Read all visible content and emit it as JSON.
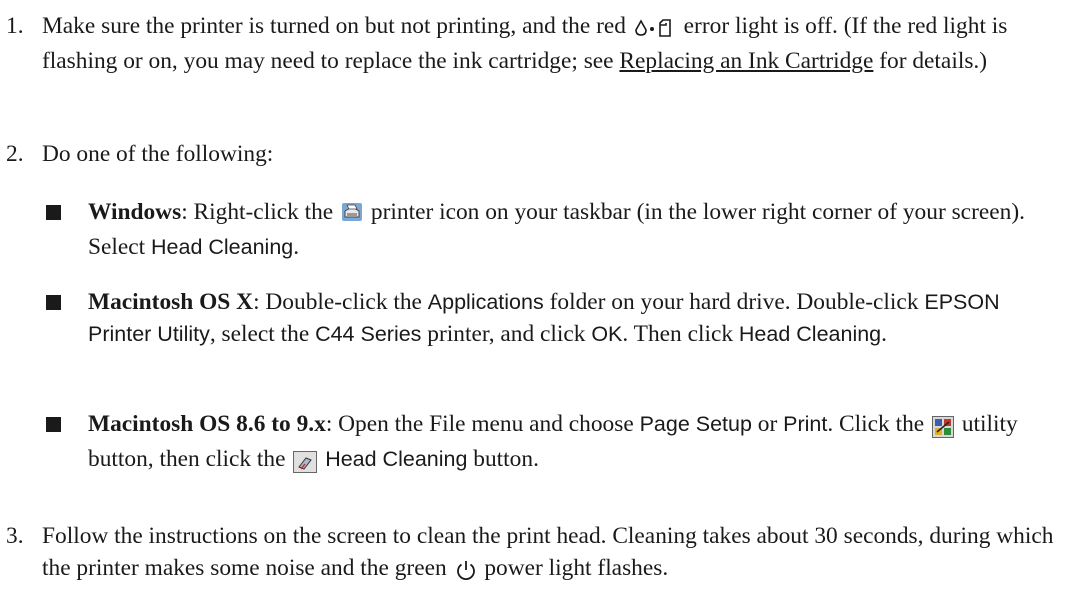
{
  "steps": [
    {
      "number": "1.",
      "t1": "Make sure the printer is turned on but not printing, and the red ",
      "t2": " error light is off. (If the red light is flashing or on, you may need to replace the ink cartridge; see ",
      "link": "Replacing an Ink Cartridge",
      "t3": " for details.)",
      "icon": "error-light-icon"
    },
    {
      "number": "2.",
      "text": "Do one of the following:"
    },
    {
      "number": "3.",
      "t1": "Follow the instructions on the screen to clean the print head. Cleaning takes about 30 seconds, during which the printer makes some noise and the green ",
      "t2": " power light flashes.",
      "icon": "power-icon"
    }
  ],
  "bullets": [
    {
      "heading": "Windows",
      "t1": ": Right-click the ",
      "t2": " printer icon on your taskbar (in the lower right corner of your screen). Select ",
      "ui1": "Head Cleaning",
      "t3": ".",
      "icon": "printer-taskbar-icon"
    },
    {
      "heading": "Macintosh OS X",
      "t1": ": Double-click the ",
      "ui1": "Applications",
      "t2": " folder on your hard drive. Double-click ",
      "ui2": "EPSON Printer Utility",
      "t3": ", select the ",
      "ui3": "C44 Series",
      "t4": " printer, and click ",
      "ui4": "OK",
      "t5": ". Then click ",
      "ui5": "Head Cleaning",
      "t6": "."
    },
    {
      "heading": "Macintosh OS 8.6 to 9.x",
      "t1": ": Open the File menu and choose ",
      "ui1": "Page Setup",
      "t2": " or ",
      "ui2": "Print",
      "t3": ". Click the ",
      "t4": " utility button, then click the ",
      "ui3": "Head Cleaning",
      "t5": " button.",
      "icon1": "utility-icon",
      "icon2": "head-cleaning-icon"
    }
  ]
}
